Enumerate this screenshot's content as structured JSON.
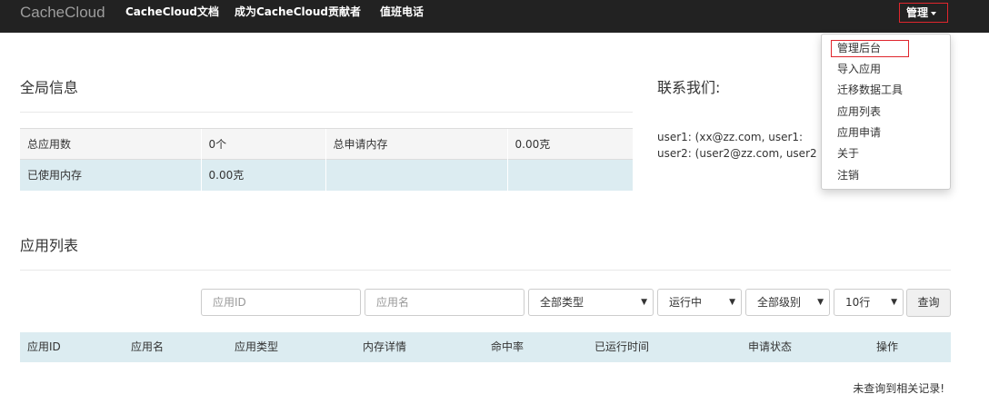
{
  "navbar": {
    "brand": "CacheCloud",
    "links": [
      "CacheCloud文档",
      "成为CacheCloud贡献者",
      "值班电话"
    ],
    "manage_label": "管理"
  },
  "dropdown": {
    "items": [
      "管理后台",
      "导入应用",
      "迁移数据工具",
      "应用列表",
      "应用申请",
      "关于",
      "注销"
    ]
  },
  "global_info": {
    "title": "全局信息",
    "rows": [
      [
        "总应用数",
        "0个",
        "总申请内存",
        "0.00克"
      ],
      [
        "已使用内存",
        "0.00克",
        "",
        ""
      ]
    ]
  },
  "contact": {
    "title": "联系我们:",
    "lines": [
      "user1:   (xx@zz.com, user1:",
      "user2:   (user2@zz.com, user2"
    ]
  },
  "app_list": {
    "title": "应用列表",
    "filters": {
      "app_id_placeholder": "应用ID",
      "app_name_placeholder": "应用名",
      "type_selected": "全部类型",
      "status_selected": "运行中",
      "level_selected": "全部级别",
      "page_size_selected": "10行",
      "query_label": "查询"
    },
    "columns": [
      "应用ID",
      "应用名",
      "应用类型",
      "内存详情",
      "命中率",
      "已运行时间",
      "申请状态",
      "操作"
    ],
    "empty_message": "未查询到相关记录!"
  }
}
